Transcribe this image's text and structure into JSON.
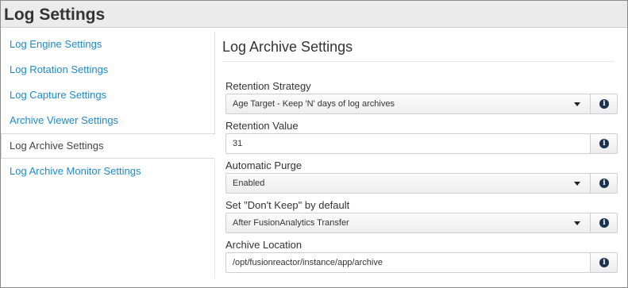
{
  "header": {
    "title": "Log Settings"
  },
  "sidebar": {
    "items": [
      {
        "label": "Log Engine Settings"
      },
      {
        "label": "Log Rotation Settings"
      },
      {
        "label": "Log Capture Settings"
      },
      {
        "label": "Archive Viewer Settings"
      },
      {
        "label": "Log Archive Settings"
      },
      {
        "label": "Log Archive Monitor Settings"
      }
    ],
    "active_item": "Log Archive Settings"
  },
  "main": {
    "title": "Log Archive Settings",
    "fields": {
      "retention_strategy": {
        "label": "Retention Strategy",
        "value": "Age Target - Keep 'N' days of log archives"
      },
      "retention_value": {
        "label": "Retention Value",
        "value": "31"
      },
      "automatic_purge": {
        "label": "Automatic Purge",
        "value": "Enabled"
      },
      "dont_keep_default": {
        "label": "Set \"Don't Keep\" by default",
        "value": "After FusionAnalytics Transfer"
      },
      "archive_location": {
        "label": "Archive Location",
        "value": "/opt/fusionreactor/instance/app/archive"
      }
    }
  },
  "icons": {
    "info": "info-icon",
    "dropdown": "caret-down-icon"
  },
  "colors": {
    "link": "#1d8acb",
    "info_icon_bg": "#18324f",
    "header_bg": "#ebebeb"
  }
}
